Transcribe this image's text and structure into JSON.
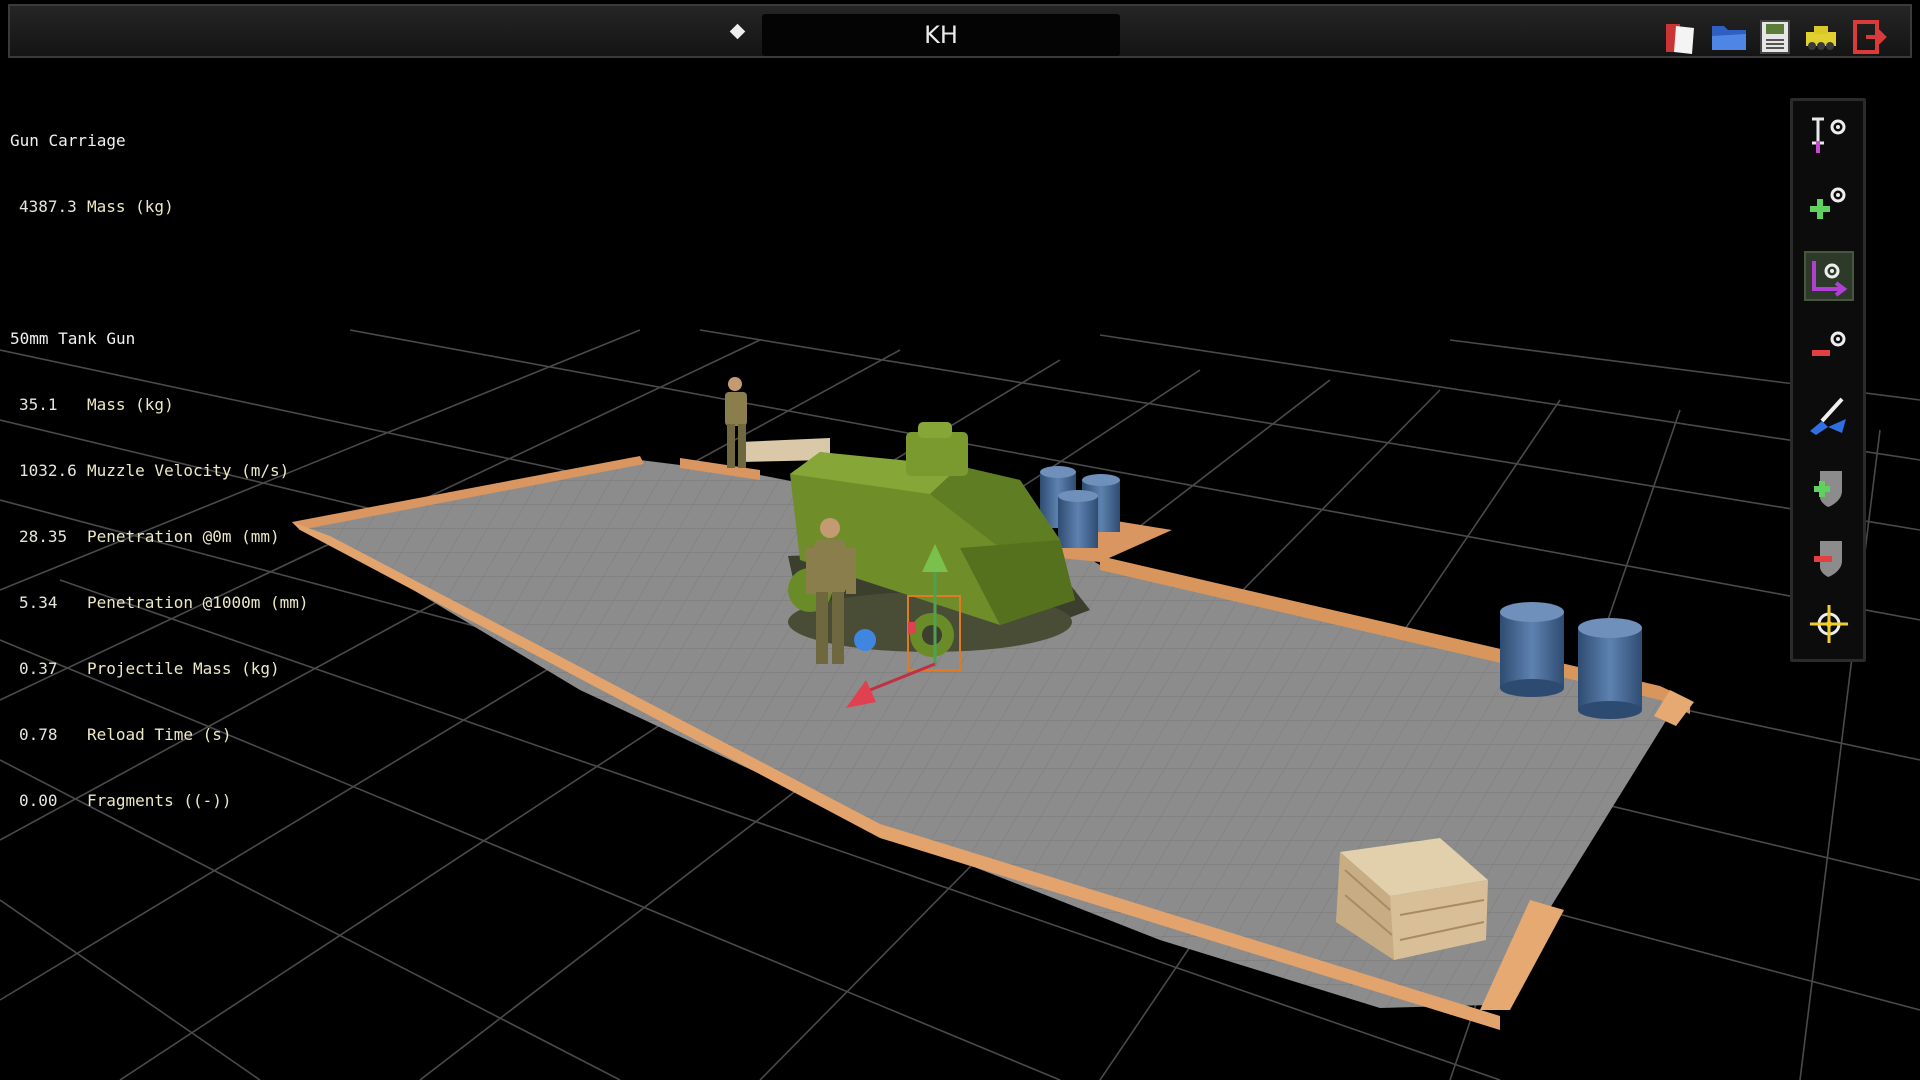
{
  "title": "KH",
  "stats": {
    "part1": {
      "name": "Gun Carriage",
      "rows": [
        {
          "value": "4387.3",
          "label": "Mass (kg)"
        }
      ]
    },
    "part2": {
      "name": "50mm Tank Gun",
      "rows": [
        {
          "value": "35.1",
          "label": "Mass (kg)"
        },
        {
          "value": "1032.6",
          "label": "Muzzle Velocity (m/s)"
        },
        {
          "value": "28.35",
          "label": "Penetration @0m (mm)"
        },
        {
          "value": "5.34",
          "label": "Penetration @1000m (mm)"
        },
        {
          "value": "0.37",
          "label": "Projectile Mass (kg)"
        },
        {
          "value": "0.78",
          "label": "Reload Time (s)"
        },
        {
          "value": "0.00",
          "label": "Fragments ((-))"
        }
      ]
    }
  },
  "top_icons": [
    "new-document-icon",
    "open-folder-icon",
    "save-icon",
    "vehicle-icon",
    "exit-icon"
  ],
  "tools": [
    {
      "name": "part-settings-icon",
      "active": false
    },
    {
      "name": "add-part-icon",
      "active": false
    },
    {
      "name": "attach-part-icon",
      "active": true
    },
    {
      "name": "remove-part-icon",
      "active": false
    },
    {
      "name": "paint-brush-icon",
      "active": false
    },
    {
      "name": "add-armor-icon",
      "active": false
    },
    {
      "name": "remove-armor-icon",
      "active": false
    },
    {
      "name": "center-target-icon",
      "active": false
    }
  ],
  "colors": {
    "floor": "#8a8a8a",
    "wall": "#d8955c",
    "tank": "#6f8e2a",
    "barrel": "#4a6a92",
    "crate": "#d8c09a",
    "grid": "#555555"
  }
}
